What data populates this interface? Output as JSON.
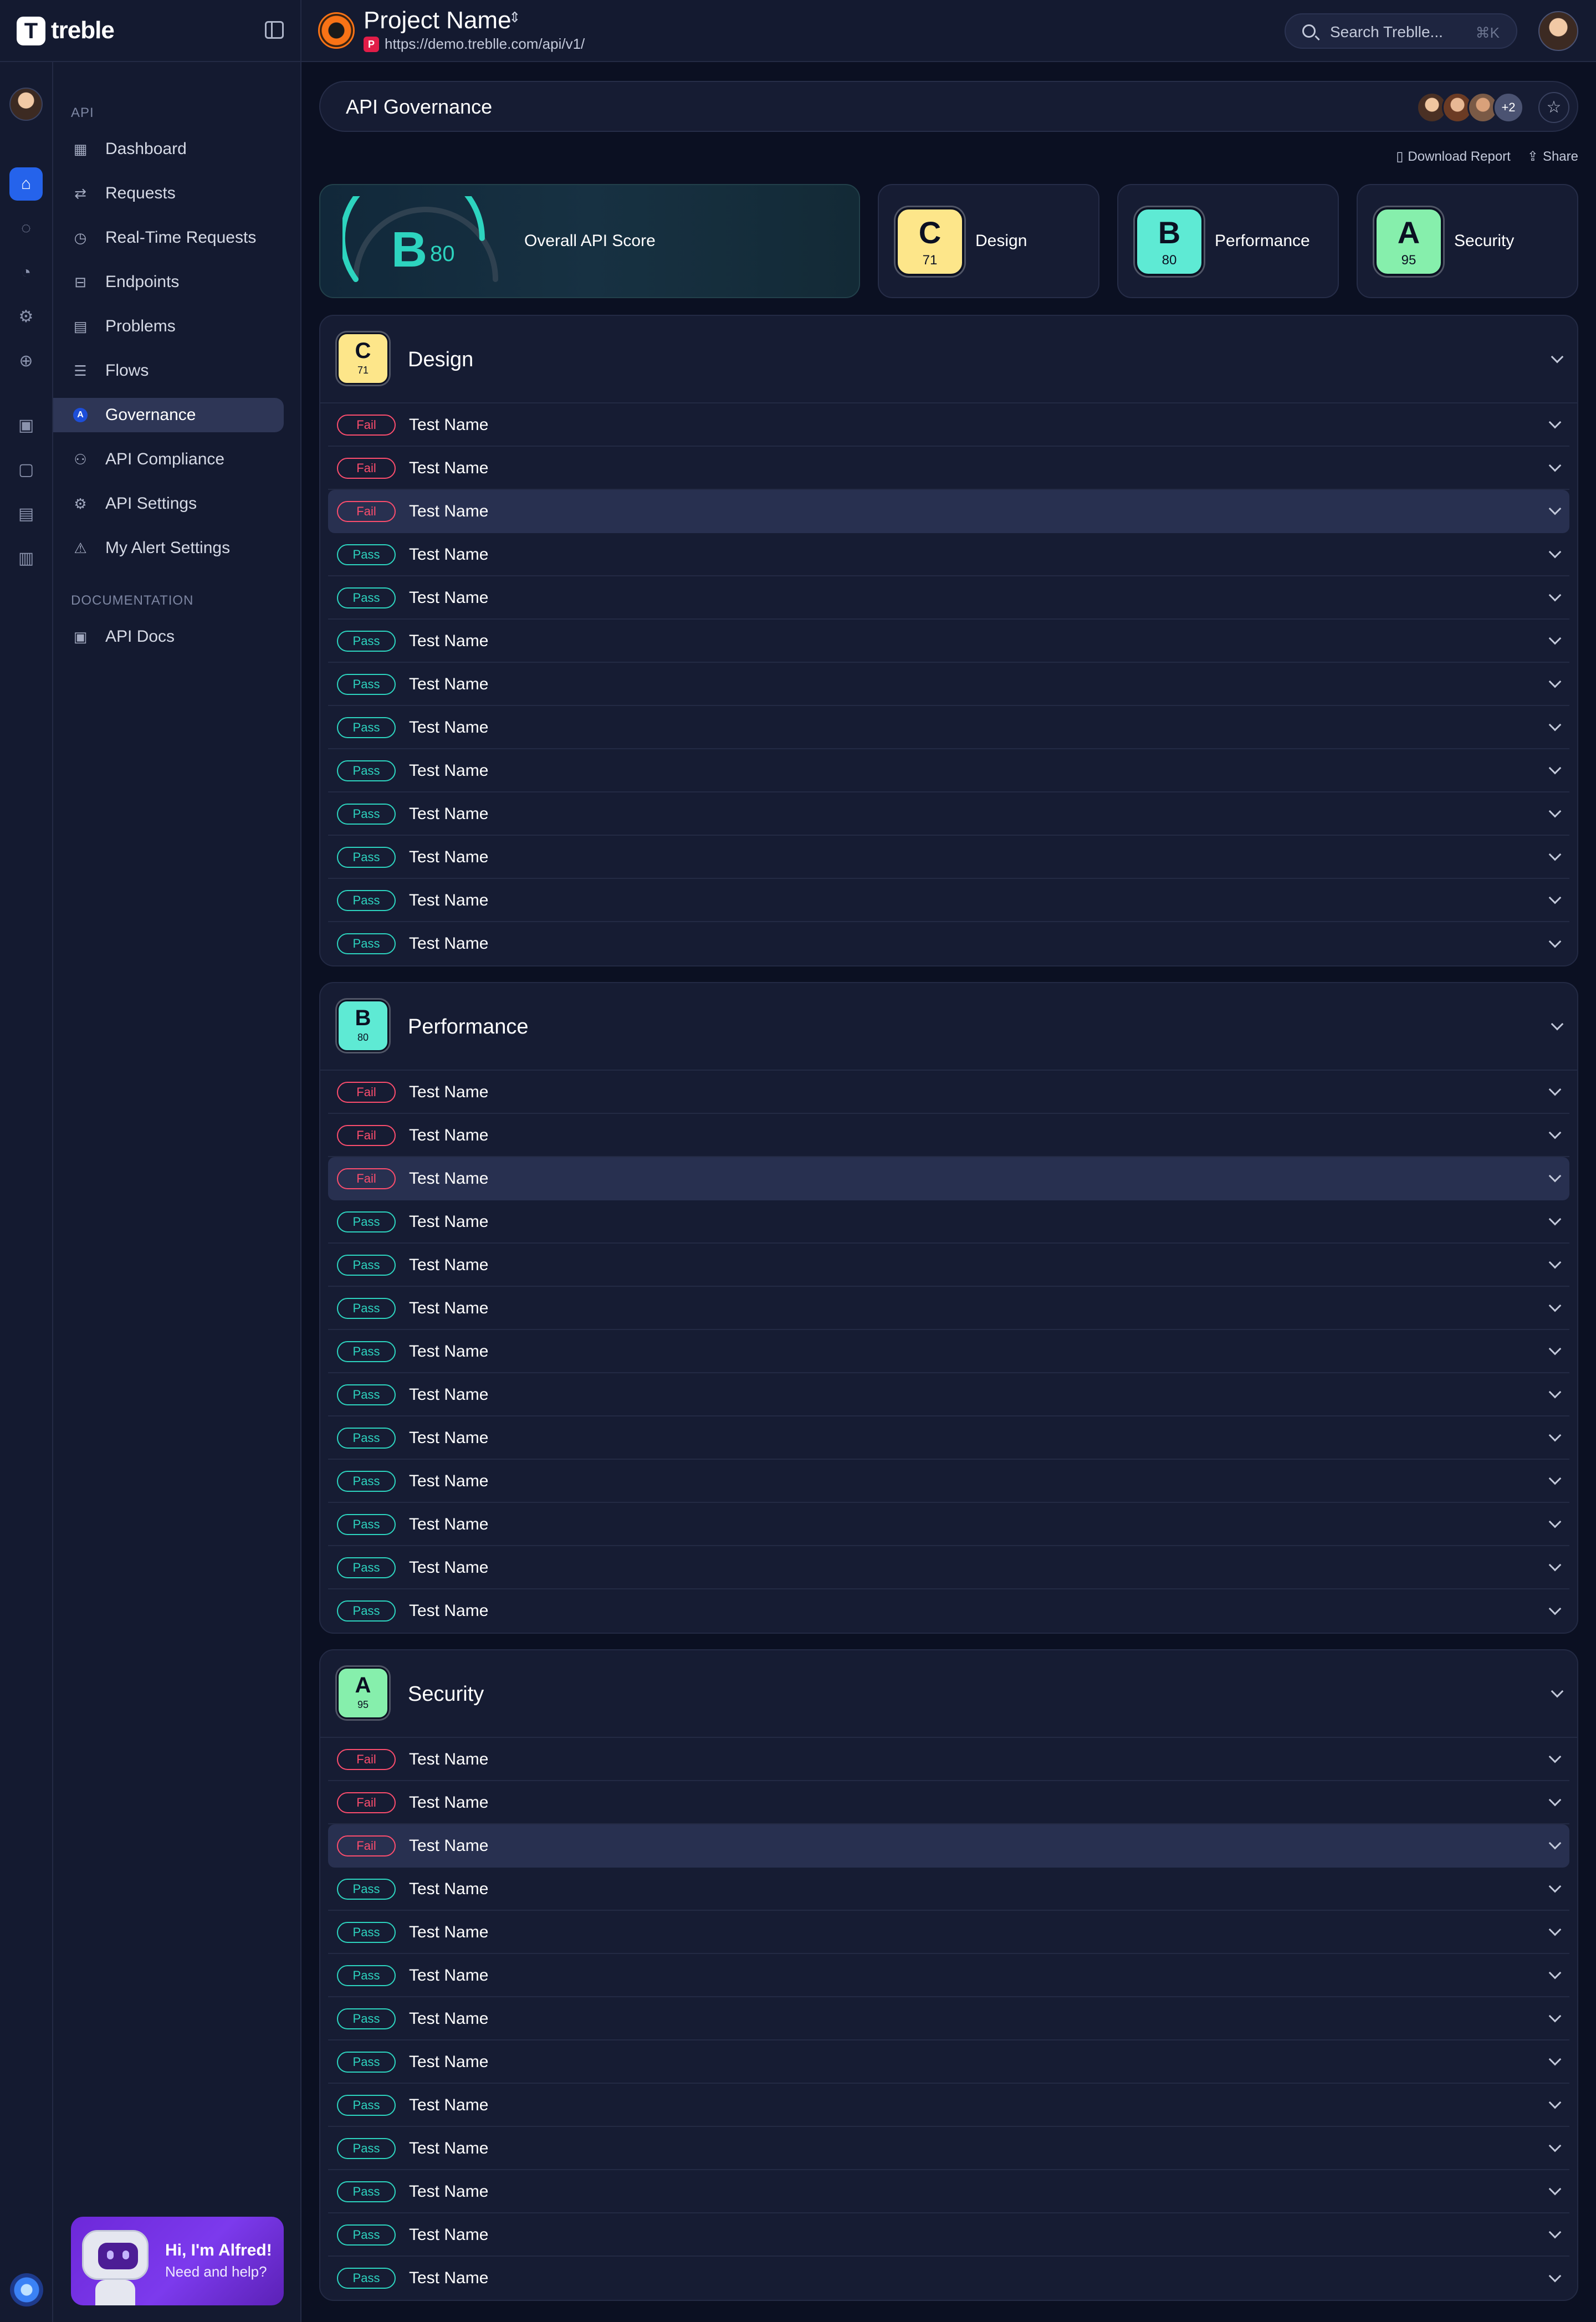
{
  "app": {
    "logo_text": "treble"
  },
  "project": {
    "name": "Project Name",
    "badge": "P",
    "url": "https://demo.treblle.com/api/v1/"
  },
  "search": {
    "placeholder": "Search Treblle...",
    "shortcut": "⌘K"
  },
  "nav": {
    "section_api": "API",
    "items": [
      {
        "label": "Dashboard",
        "icon": "dashboard-icon"
      },
      {
        "label": "Requests",
        "icon": "arrows-icon"
      },
      {
        "label": "Real-Time Requests",
        "icon": "timer-icon"
      },
      {
        "label": "Endpoints",
        "icon": "endpoints-icon"
      },
      {
        "label": "Problems",
        "icon": "problems-icon"
      },
      {
        "label": "Flows",
        "icon": "flows-icon"
      },
      {
        "label": "Governance",
        "icon": "governance-icon",
        "active": true
      },
      {
        "label": "API Compliance",
        "icon": "compliance-icon"
      },
      {
        "label": "API Settings",
        "icon": "settings-gear-icon"
      },
      {
        "label": "My Alert Settings",
        "icon": "alert-triangle-icon"
      }
    ],
    "section_docs": "DOCUMENTATION",
    "docs_items": [
      {
        "label": "API Docs",
        "icon": "docs-icon"
      }
    ]
  },
  "alfred": {
    "title": "Hi, I'm Alfred!",
    "subtitle": "Need and help?"
  },
  "page": {
    "title": "API Governance",
    "collaborators_more": "+2",
    "download_label": "Download Report",
    "share_label": "Share"
  },
  "overall": {
    "grade": "B",
    "score": "80",
    "label": "Overall API Score",
    "score_fraction": 0.8
  },
  "categories": [
    {
      "name": "Design",
      "grade": "C",
      "score": "71",
      "color": "#fde68a"
    },
    {
      "name": "Performance",
      "grade": "B",
      "score": "80",
      "color": "#5eead4"
    },
    {
      "name": "Security",
      "grade": "A",
      "score": "95",
      "color": "#86efac"
    }
  ],
  "status_labels": {
    "fail": "Fail",
    "pass": "Pass"
  },
  "sections": [
    {
      "title": "Design",
      "grade": "C",
      "score": "71",
      "color": "#fde68a",
      "tests": [
        {
          "status": "fail",
          "name": "Test Name"
        },
        {
          "status": "fail",
          "name": "Test Name"
        },
        {
          "status": "fail",
          "name": "Test Name",
          "highlighted": true
        },
        {
          "status": "pass",
          "name": "Test Name"
        },
        {
          "status": "pass",
          "name": "Test Name"
        },
        {
          "status": "pass",
          "name": "Test Name"
        },
        {
          "status": "pass",
          "name": "Test Name"
        },
        {
          "status": "pass",
          "name": "Test Name"
        },
        {
          "status": "pass",
          "name": "Test Name"
        },
        {
          "status": "pass",
          "name": "Test Name"
        },
        {
          "status": "pass",
          "name": "Test Name"
        },
        {
          "status": "pass",
          "name": "Test Name"
        },
        {
          "status": "pass",
          "name": "Test Name"
        }
      ]
    },
    {
      "title": "Performance",
      "grade": "B",
      "score": "80",
      "color": "#5eead4",
      "tests": [
        {
          "status": "fail",
          "name": "Test Name"
        },
        {
          "status": "fail",
          "name": "Test Name"
        },
        {
          "status": "fail",
          "name": "Test Name",
          "highlighted": true
        },
        {
          "status": "pass",
          "name": "Test Name"
        },
        {
          "status": "pass",
          "name": "Test Name"
        },
        {
          "status": "pass",
          "name": "Test Name"
        },
        {
          "status": "pass",
          "name": "Test Name"
        },
        {
          "status": "pass",
          "name": "Test Name"
        },
        {
          "status": "pass",
          "name": "Test Name"
        },
        {
          "status": "pass",
          "name": "Test Name"
        },
        {
          "status": "pass",
          "name": "Test Name"
        },
        {
          "status": "pass",
          "name": "Test Name"
        },
        {
          "status": "pass",
          "name": "Test Name"
        }
      ]
    },
    {
      "title": "Security",
      "grade": "A",
      "score": "95",
      "color": "#86efac",
      "tests": [
        {
          "status": "fail",
          "name": "Test Name"
        },
        {
          "status": "fail",
          "name": "Test Name"
        },
        {
          "status": "fail",
          "name": "Test Name",
          "highlighted": true
        },
        {
          "status": "pass",
          "name": "Test Name"
        },
        {
          "status": "pass",
          "name": "Test Name"
        },
        {
          "status": "pass",
          "name": "Test Name"
        },
        {
          "status": "pass",
          "name": "Test Name"
        },
        {
          "status": "pass",
          "name": "Test Name"
        },
        {
          "status": "pass",
          "name": "Test Name"
        },
        {
          "status": "pass",
          "name": "Test Name"
        },
        {
          "status": "pass",
          "name": "Test Name"
        },
        {
          "status": "pass",
          "name": "Test Name"
        },
        {
          "status": "pass",
          "name": "Test Name"
        }
      ]
    }
  ]
}
